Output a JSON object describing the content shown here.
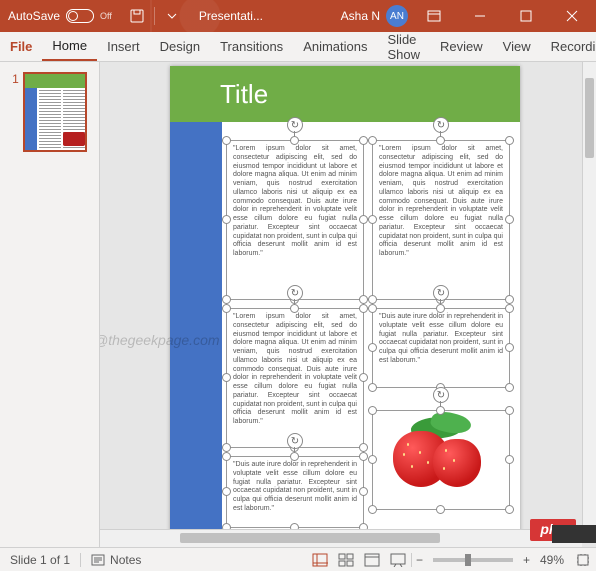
{
  "titlebar": {
    "autosave_label": "AutoSave",
    "autosave_state": "Off",
    "doc_name": "Presentati...",
    "user_name": "Asha N",
    "user_initials": "AN"
  },
  "ribbon": {
    "tabs": [
      "File",
      "Home",
      "Insert",
      "Design",
      "Transitions",
      "Animations",
      "Slide Show",
      "Review",
      "View",
      "Recordi"
    ],
    "active_index": 1
  },
  "thumb": {
    "number": "1"
  },
  "slide": {
    "title": "Title",
    "lorem_long": "\"Lorem ipsum dolor sit amet, consectetur adipiscing elit, sed do eiusmod tempor incididunt ut labore et dolore magna aliqua. Ut enim ad minim veniam, quis nostrud exercitation ullamco laboris nisi ut aliquip ex ea commodo consequat. Duis aute irure dolor in reprehenderit in voluptate velit esse cillum dolore eu fugiat nulla pariatur. Excepteur sint occaecat cupidatat non proident, sunt in culpa qui officia deserunt mollit anim id est laborum.\"",
    "lorem_mid": "\"Lorem ipsum dolor sit amet, consectetur adipiscing elit, sed do eiusmod tempor incididunt ut labore et dolore magna aliqua. Ut enim ad minim veniam, quis nostrud exercitation ullamco laboris nisi ut aliquip ex ea commodo consequat. Duis aute irure dolor in reprehenderit in voluptate velit esse cillum dolore eu fugiat nulla pariatur. Excepteur sint occaecat cupidatat non proident, sunt in culpa qui officia deserunt mollit anim id est laborum.\"",
    "lorem_short": "\"Duis aute irure dolor in reprehenderit in voluptate velit esse cillum dolore eu fugiat nulla pariatur. Excepteur sint occaecat cupidatat non proident, sunt in culpa qui officia deserunt mollit anim id est laborum.\"",
    "lorem_short2": "\"Duis aute irure dolor in reprehenderit in voluptate velit esse cillum dolore eu fugiat nulla pariatur. Excepteur sint occaecat cupidatat non proident, sunt in culpa qui officia deserunt mollit anim id est laborum.\""
  },
  "watermark": "@thegeekpage.com",
  "badge": "php",
  "status": {
    "slide_info": "Slide 1 of 1",
    "notes_label": "Notes",
    "zoom_pct": "49%",
    "zoom_pos_pct": 40
  }
}
